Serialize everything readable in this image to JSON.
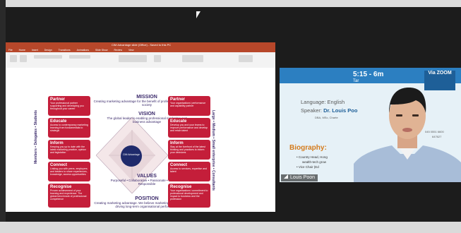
{
  "shared_screen": {
    "ppt_window_title": "CIM Advantage slide (Office) - Saved to this PC",
    "ribbon_tabs": [
      "File",
      "Home",
      "Insert",
      "Design",
      "Transitions",
      "Animations",
      "Slide Show",
      "Review",
      "View"
    ],
    "slide": {
      "mission_heading": "MISSION",
      "mission_text": "Creating marketing advantage for the benefit of professionals, business and society",
      "vision_heading": "VISION",
      "vision_text": "The global leader in enabling professional marketing and business advantage",
      "values_heading": "VALUES",
      "values_text": "Purposeful • Collaborative • Passionate • Relevant • Responsible",
      "position_heading": "POSITION",
      "position_text": "Creating marketing advantage. We believe marketing is the critical factor in driving long-term organisational performance",
      "center_label": "CIM Advantage",
      "left_side_label": "Members • Delegates • Students",
      "right_side_label": "Large • Medium • Small enterprise • Consultants",
      "left_cards": [
        {
          "heading": "Partner",
          "body": "Your professional partner supporting and developing you throughout your career"
        },
        {
          "heading": "Educate",
          "body": "Access to contemporary marketing learning from fundamentals to strategic"
        },
        {
          "heading": "Inform",
          "body": "Keeping you up to date with the latest marketing practice, opinion and legislation"
        },
        {
          "heading": "Connect",
          "body": "Linking you with peers, employers and leaders to share experiences, knowledge, access opportunities"
        },
        {
          "heading": "Recognise",
          "body": "Proven achievement of your learning and experience. The global benchmark of professional competence"
        }
      ],
      "right_cards": [
        {
          "heading": "Partner",
          "body": "Your organisations' performance and capability partner"
        },
        {
          "heading": "Educate",
          "body": "Develop you and your teams to improve performance and develop and retain talent"
        },
        {
          "heading": "Inform",
          "body": "Stay at the forefront of the latest thinking and practices to inform your decisions"
        },
        {
          "heading": "Connect",
          "body": "Access to services, expertise and talent"
        },
        {
          "heading": "Recognise",
          "body": "Your organisations' commitment to professional development and impact to business and the profession"
        }
      ]
    }
  },
  "speaker_video": {
    "time": "5:15 - 6",
    "time_suffix": "m",
    "subline": "Tar",
    "via_badge": "Via ZOOM",
    "language": "Language: English",
    "speaker_prefix": "Speaker: ",
    "speaker_name": "Dr. Louis Poo",
    "degrees": "DBA, MSc, Charte",
    "biography_heading": "Biography:",
    "bio_lines": [
      "• Country Head, Hong",
      "wealth-tech grow",
      "• Vice Chair (Ed"
    ],
    "phone_1": "045 0551 6600",
    "phone_2": "647627",
    "participant_name": "Louis Poon"
  },
  "colors": {
    "card_red": "#c41e3a",
    "heading_purple": "#3b2a6b",
    "zoom_blue": "#2c7fc1",
    "bio_orange": "#d47b1c"
  }
}
